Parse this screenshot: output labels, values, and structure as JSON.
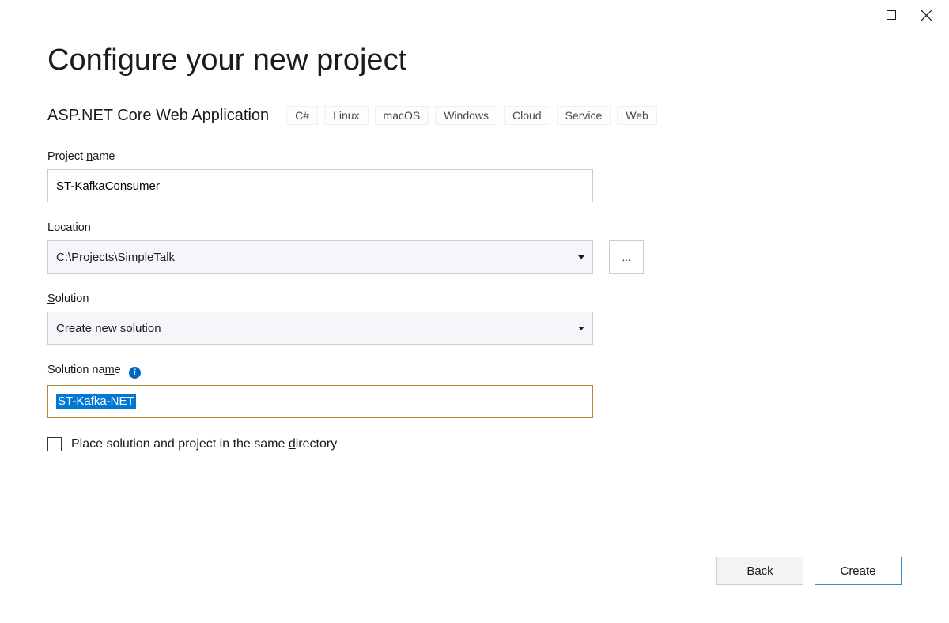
{
  "title": "Configure your new project",
  "template": {
    "name": "ASP.NET Core Web Application",
    "tags": [
      "C#",
      "Linux",
      "macOS",
      "Windows",
      "Cloud",
      "Service",
      "Web"
    ]
  },
  "fields": {
    "project_name_label": "Project name",
    "project_name_value": "ST-KafkaConsumer",
    "location_label": "Location",
    "location_value": "C:\\Projects\\SimpleTalk",
    "browse_label": "...",
    "solution_label": "Solution",
    "solution_value": "Create new solution",
    "solution_name_label": "Solution name",
    "solution_name_value": "ST-Kafka-NET",
    "same_dir_label": "Place solution and project in the same directory"
  },
  "footer": {
    "back_label": "Back",
    "create_label": "Create"
  }
}
